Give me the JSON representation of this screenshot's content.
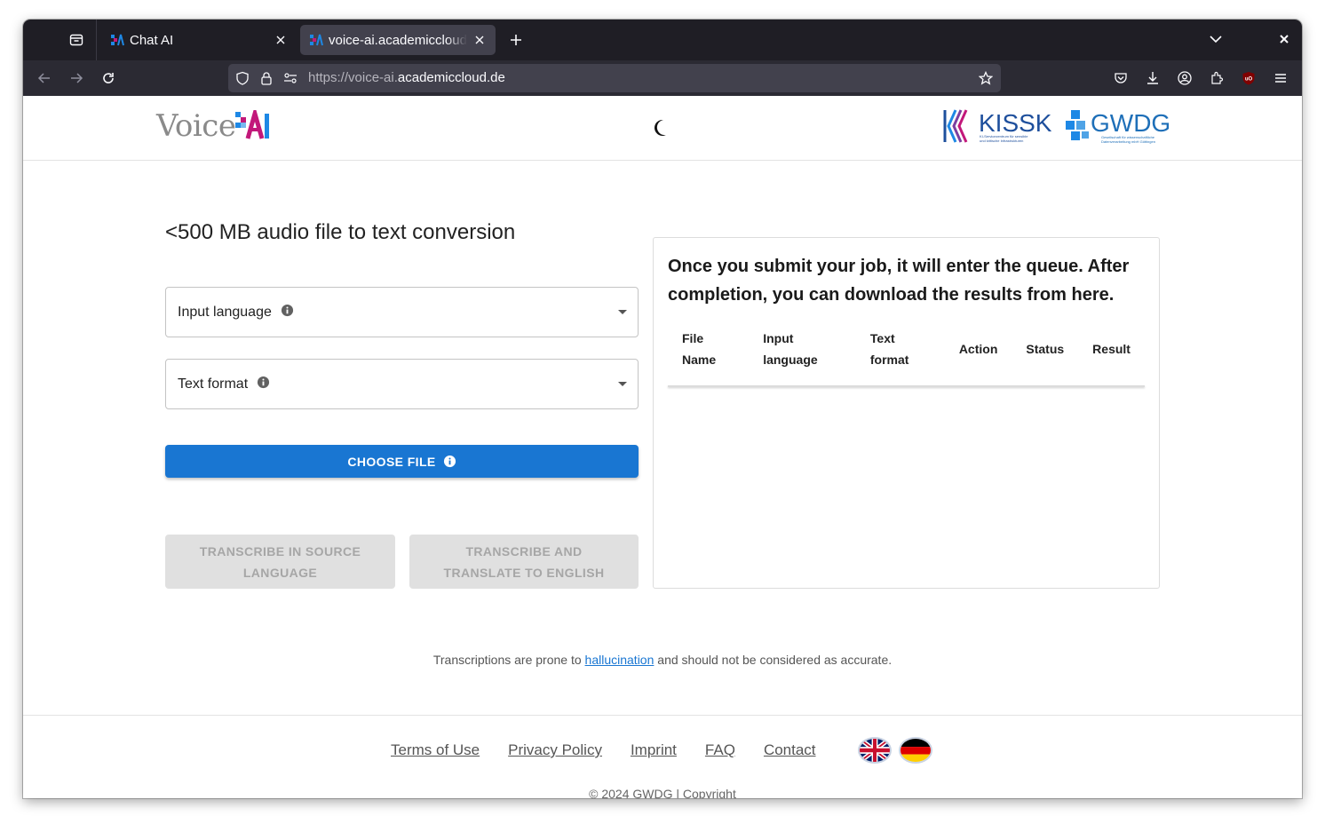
{
  "browser": {
    "tabs": [
      {
        "title": "Chat AI",
        "active": false
      },
      {
        "title": "voice-ai.academiccloud.de",
        "active": true
      }
    ],
    "url_prefix": "https://voice-ai.",
    "url_domain": "academiccloud.de"
  },
  "header": {
    "logo_word": "Voice",
    "logo_ai": "AI",
    "kisski_text": "KISSKI",
    "kisski_sub": "KI-Servicezentrum für sensible und kritische Infrastrukturen",
    "gwdg_text": "GWDG",
    "gwdg_sub": "Gesellschaft für wissenschaftliche Datenverarbeitung mbH Göttingen"
  },
  "form": {
    "heading": "<500 MB audio file to text conversion",
    "input_language_label": "Input language",
    "text_format_label": "Text format",
    "choose_file_label": "CHOOSE FILE",
    "transcribe_source_label": "TRANSCRIBE IN SOURCE LANGUAGE",
    "transcribe_translate_label": "TRANSCRIBE AND TRANSLATE TO ENGLISH"
  },
  "results": {
    "message": "Once you submit your job, it will enter the queue. After completion, you can download the results from here.",
    "columns": [
      "File Name",
      "Input language",
      "Text format",
      "Action",
      "Status",
      "Result"
    ]
  },
  "disclaimer": {
    "before": "Transcriptions are prone to ",
    "link": "hallucination",
    "after": " and should not be considered as accurate."
  },
  "footer": {
    "links": [
      "Terms of Use",
      "Privacy Policy",
      "Imprint",
      "FAQ",
      "Contact"
    ],
    "copyright": "© 2024 GWDG | Copyright"
  },
  "colors": {
    "primary": "#1976d2",
    "brand_pink": "#c2187a",
    "brand_blue": "#1e88e5"
  }
}
